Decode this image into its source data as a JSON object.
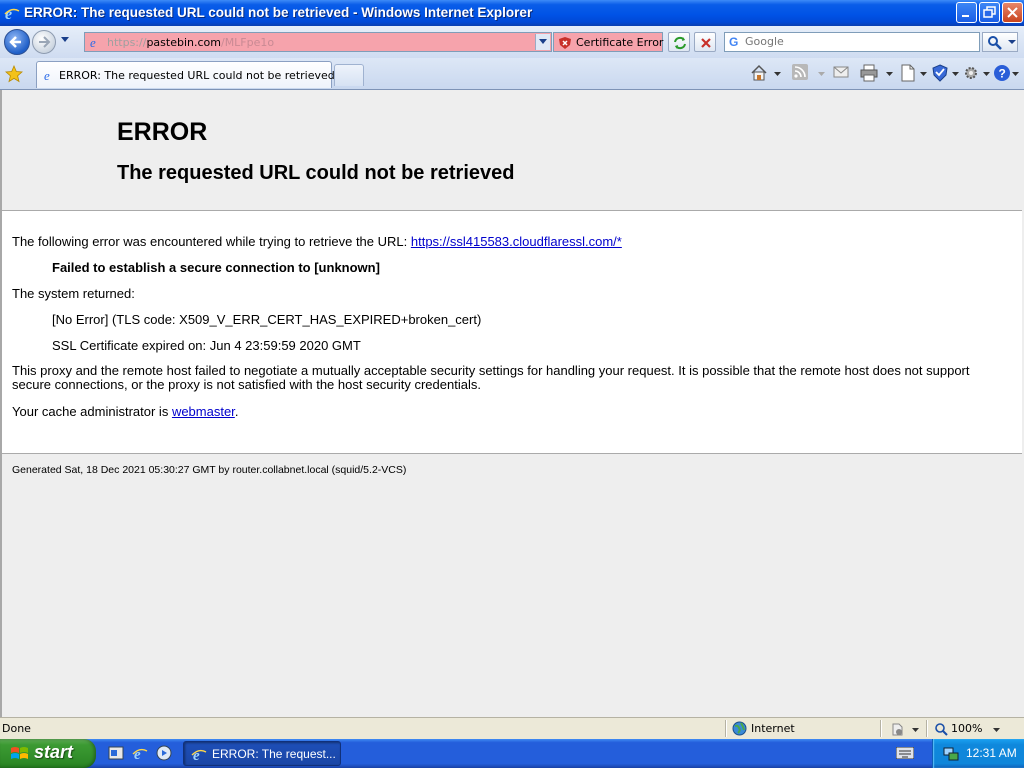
{
  "window": {
    "title": "ERROR: The requested URL could not be retrieved - Windows Internet Explorer"
  },
  "navbar": {
    "url_scheme": "https://",
    "url_host": "pastebin.com",
    "url_path": "/MLFpe1o",
    "certificate_error_label": "Certificate Error",
    "search_placeholder": "Google"
  },
  "tabs": {
    "active_label": "ERROR: The requested URL could not be retrieved"
  },
  "page": {
    "heading": "ERROR",
    "subheading": "The requested URL could not be retrieved",
    "intro_text": "The following error was encountered while trying to retrieve the URL: ",
    "intro_link": "https://ssl415583.cloudflaressl.com/*",
    "failure_text": "Failed to establish a secure connection to [unknown]",
    "system_returned": "The system returned:",
    "tls_code": "[No Error] (TLS code: X509_V_ERR_CERT_HAS_EXPIRED+broken_cert)",
    "cert_expired": "SSL Certificate expired on: Jun 4 23:59:59 2020 GMT",
    "explanation": "This proxy and the remote host failed to negotiate a mutually acceptable security settings for handling your request. It is possible that the remote host does not support secure connections, or the proxy is not satisfied with the host security credentials.",
    "cache_admin_text": "Your cache administrator is ",
    "cache_admin_link": "webmaster",
    "cache_admin_end": ".",
    "footer": "Generated Sat, 18 Dec 2021 05:30:27 GMT by router.collabnet.local (squid/5.2-VCS)"
  },
  "statusbar": {
    "status": "Done",
    "zone": "Internet",
    "zoom": "100%"
  },
  "taskbar": {
    "start_label": "start",
    "task_label": "ERROR: The request...",
    "clock": "12:31 AM"
  },
  "colors": {
    "address_error_bg": "#f6a3ac",
    "link": "#0000cc",
    "titlebar": "#0053e6",
    "start_button": "#3c9a33"
  }
}
